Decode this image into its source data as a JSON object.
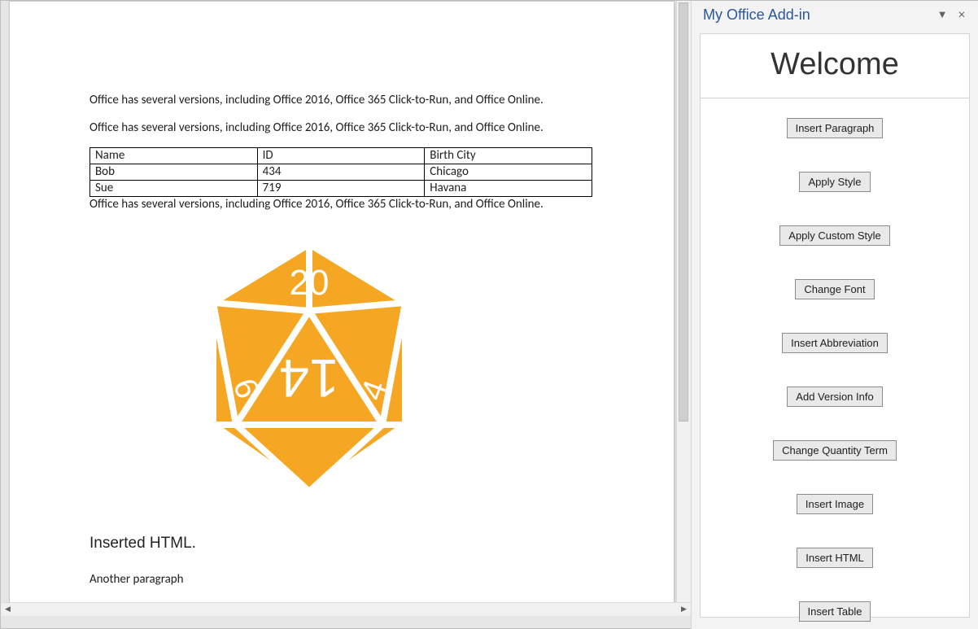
{
  "document": {
    "paragraphs": [
      "Office has several versions, including Office 2016, Office 365 Click-to-Run, and Office Online.",
      "Office has several versions, including Office 2016, Office 365 Click-to-Run, and Office Online.",
      "Office has several versions, including Office 2016, Office 365 Click-to-Run, and Office Online."
    ],
    "table": {
      "headers": [
        "Name",
        "ID",
        "Birth City"
      ],
      "rows": [
        [
          "Bob",
          "434",
          "Chicago"
        ],
        [
          "Sue",
          "719",
          "Havana"
        ]
      ]
    },
    "dice": {
      "top_number": "20",
      "center_number": "14",
      "left_number": "6",
      "right_number": "4",
      "color": "#F5A623"
    },
    "inserted_html_heading": "Inserted HTML.",
    "another_paragraph": "Another paragraph"
  },
  "pane": {
    "title": "My Office Add-in",
    "welcome": "Welcome",
    "buttons": [
      "Insert Paragraph",
      "Apply Style",
      "Apply Custom Style",
      "Change Font",
      "Insert Abbreviation",
      "Add Version Info",
      "Change Quantity Term",
      "Insert Image",
      "Insert HTML",
      "Insert Table"
    ]
  }
}
